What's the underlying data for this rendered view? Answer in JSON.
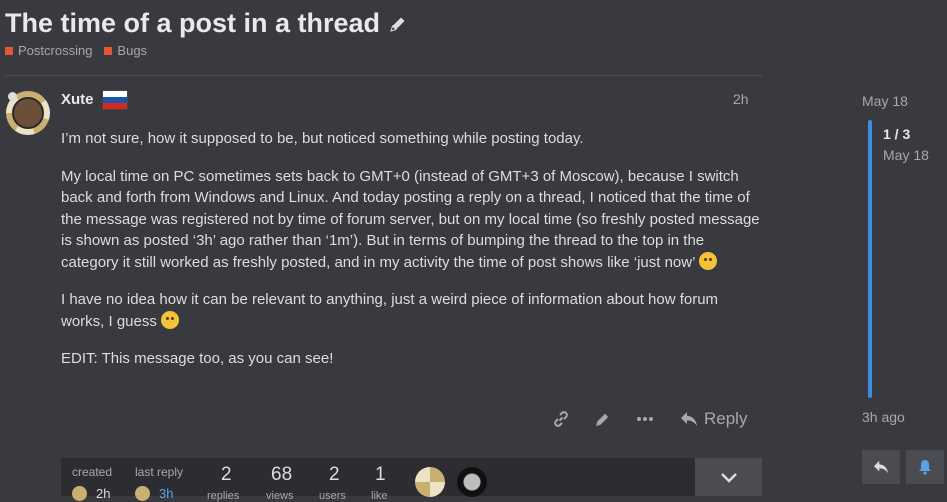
{
  "topic": {
    "title": "The time of a post in a thread",
    "categories": [
      "Postcrossing",
      "Bugs"
    ]
  },
  "post": {
    "username": "Xute",
    "time": "2h",
    "paragraphs": [
      "I’m not sure, how it supposed to be, but noticed something while posting today.",
      "My local time on PC sometimes sets back to GMT+0 (instead of GMT+3 of Moscow), because I switch back and forth from Windows and Linux. And today posting a reply on a thread, I noticed that the time of the message was registered not by time of forum server, but on my local time (so freshly posted message is shown as posted ‘3h’ ago rather than ‘1m’). But in terms of bumping the thread to the top in the category it still worked as freshly posted, and in my activity the time of post shows like ‘just now’",
      "I have no idea how it can be relevant to anything, just a weird piece of information about how forum works, I guess",
      "EDIT: This message too, as you can see!"
    ],
    "actions": {
      "reply_label": "Reply",
      "icons": [
        "link-icon",
        "pencil-icon",
        "more-icon",
        "reply-icon"
      ]
    }
  },
  "topic_map": {
    "created_label": "created",
    "created_time": "2h",
    "last_reply_label": "last reply",
    "last_reply_time": "3h",
    "replies": "2",
    "replies_label": "replies",
    "views": "68",
    "views_label": "views",
    "users": "2",
    "users_label": "users",
    "likes": "1",
    "likes_label": "like"
  },
  "timeline": {
    "start_date": "May 18",
    "position": "1 / 3",
    "position_date": "May 18",
    "end_label": "3h ago"
  },
  "colors": {
    "background": "#383a3f",
    "accent_blue": "#3b8ee0",
    "category_red": "#e45735"
  }
}
